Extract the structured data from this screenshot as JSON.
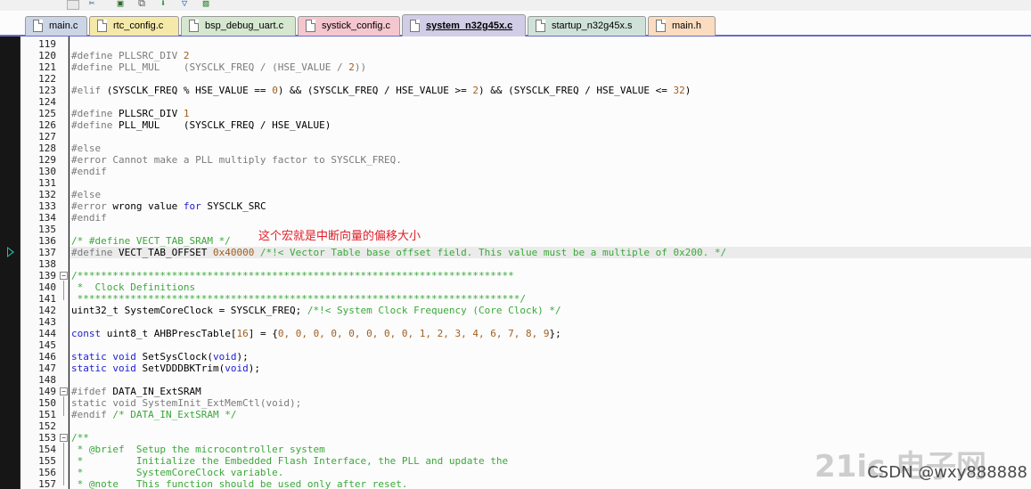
{
  "toolbar": {
    "icons": [
      "dropdown-icon",
      "tools-icon",
      "save-icon",
      "windows-icon",
      "download-icon",
      "filter-icon",
      "image-icon"
    ]
  },
  "tabs": [
    {
      "label": "main.c",
      "color": "#cbd5e6",
      "active": false
    },
    {
      "label": "rtc_config.c",
      "color": "#f4e9a8",
      "active": false
    },
    {
      "label": "bsp_debug_uart.c",
      "color": "#d6e7d0",
      "active": false
    },
    {
      "label": "systick_config.c",
      "color": "#f4c7cf",
      "active": false
    },
    {
      "label": "system_n32g45x.c",
      "color": "#d2cde6",
      "active": true
    },
    {
      "label": "startup_n32g45x.s",
      "color": "#cfe2da",
      "active": false
    },
    {
      "label": "main.h",
      "color": "#fbdcc0",
      "active": false
    }
  ],
  "editor": {
    "first_line": 119,
    "current_line": 137,
    "annotation": "这个宏就是中断向量的偏移大小",
    "lines": [
      {
        "n": 119,
        "segs": []
      },
      {
        "n": 120,
        "segs": [
          {
            "t": "#define",
            "c": "pp"
          },
          {
            "t": " PLLSRC_DIV ",
            "c": "pp"
          },
          {
            "t": "2",
            "c": "num"
          }
        ]
      },
      {
        "n": 121,
        "segs": [
          {
            "t": "#define",
            "c": "pp"
          },
          {
            "t": " PLL_MUL    (SYSCLK_FREQ / (HSE_VALUE / ",
            "c": "pp"
          },
          {
            "t": "2",
            "c": "num"
          },
          {
            "t": "))",
            "c": "pp"
          }
        ]
      },
      {
        "n": 122,
        "segs": []
      },
      {
        "n": 123,
        "segs": [
          {
            "t": "#elif",
            "c": "pp"
          },
          {
            "t": " (SYSCLK_FREQ % HSE_VALUE == ",
            "c": ""
          },
          {
            "t": "0",
            "c": "num"
          },
          {
            "t": ") && (SYSCLK_FREQ / HSE_VALUE >= ",
            "c": ""
          },
          {
            "t": "2",
            "c": "num"
          },
          {
            "t": ") && (SYSCLK_FREQ / HSE_VALUE <= ",
            "c": ""
          },
          {
            "t": "32",
            "c": "num"
          },
          {
            "t": ")",
            "c": ""
          }
        ]
      },
      {
        "n": 124,
        "segs": []
      },
      {
        "n": 125,
        "segs": [
          {
            "t": "#define",
            "c": "pp"
          },
          {
            "t": " PLLSRC_DIV ",
            "c": ""
          },
          {
            "t": "1",
            "c": "num"
          }
        ]
      },
      {
        "n": 126,
        "segs": [
          {
            "t": "#define",
            "c": "pp"
          },
          {
            "t": " PLL_MUL    (SYSCLK_FREQ / HSE_VALUE)",
            "c": ""
          }
        ]
      },
      {
        "n": 127,
        "segs": []
      },
      {
        "n": 128,
        "segs": [
          {
            "t": "#else",
            "c": "pp"
          }
        ]
      },
      {
        "n": 129,
        "segs": [
          {
            "t": "#error",
            "c": "pp"
          },
          {
            "t": " Cannot make a PLL multiply factor to SYSCLK_FREQ.",
            "c": "pp"
          }
        ]
      },
      {
        "n": 130,
        "segs": [
          {
            "t": "#endif",
            "c": "pp"
          }
        ]
      },
      {
        "n": 131,
        "segs": []
      },
      {
        "n": 132,
        "segs": [
          {
            "t": "#else",
            "c": "pp"
          }
        ]
      },
      {
        "n": 133,
        "segs": [
          {
            "t": "#error",
            "c": "pp"
          },
          {
            "t": " wrong value ",
            "c": ""
          },
          {
            "t": "for",
            "c": "kw"
          },
          {
            "t": " SYSCLK_SRC",
            "c": ""
          }
        ]
      },
      {
        "n": 134,
        "segs": [
          {
            "t": "#endif",
            "c": "pp"
          }
        ]
      },
      {
        "n": 135,
        "segs": []
      },
      {
        "n": 136,
        "segs": [
          {
            "t": "/* #define VECT_TAB_SRAM */",
            "c": "cm"
          }
        ]
      },
      {
        "n": 137,
        "segs": [
          {
            "t": "#define",
            "c": "pp"
          },
          {
            "t": " VECT_TAB_OFFSET ",
            "c": ""
          },
          {
            "t": "0x40000",
            "c": "num"
          },
          {
            "t": " /*!< Vector Table base offset field. This value must be a multiple of 0x200. */",
            "c": "cm"
          }
        ]
      },
      {
        "n": 138,
        "segs": []
      },
      {
        "n": 139,
        "segs": [
          {
            "t": "/**************************************************************************",
            "c": "cm"
          }
        ]
      },
      {
        "n": 140,
        "segs": [
          {
            "t": " *  Clock Definitions",
            "c": "cm"
          }
        ]
      },
      {
        "n": 141,
        "segs": [
          {
            "t": " ***************************************************************************/",
            "c": "cm"
          }
        ]
      },
      {
        "n": 142,
        "segs": [
          {
            "t": "uint32_t SystemCoreClock = SYSCLK_FREQ; ",
            "c": ""
          },
          {
            "t": "/*!< System Clock Frequency (Core Clock) */",
            "c": "cm"
          }
        ]
      },
      {
        "n": 143,
        "segs": []
      },
      {
        "n": 144,
        "segs": [
          {
            "t": "const",
            "c": "kw"
          },
          {
            "t": " uint8_t AHBPrescTable[",
            "c": ""
          },
          {
            "t": "16",
            "c": "num"
          },
          {
            "t": "] = {",
            "c": ""
          },
          {
            "t": "0, 0, 0, 0, 0, 0, 0, 0, 1, 2, 3, 4, 6, 7, 8, 9",
            "c": "num"
          },
          {
            "t": "};",
            "c": ""
          }
        ]
      },
      {
        "n": 145,
        "segs": []
      },
      {
        "n": 146,
        "segs": [
          {
            "t": "static",
            "c": "kw"
          },
          {
            "t": " ",
            "c": ""
          },
          {
            "t": "void",
            "c": "kw"
          },
          {
            "t": " SetSysClock(",
            "c": ""
          },
          {
            "t": "void",
            "c": "kw"
          },
          {
            "t": ");",
            "c": ""
          }
        ]
      },
      {
        "n": 147,
        "segs": [
          {
            "t": "static",
            "c": "kw"
          },
          {
            "t": " ",
            "c": ""
          },
          {
            "t": "void",
            "c": "kw"
          },
          {
            "t": " SetVDDDBKTrim(",
            "c": ""
          },
          {
            "t": "void",
            "c": "kw"
          },
          {
            "t": ");",
            "c": ""
          }
        ]
      },
      {
        "n": 148,
        "segs": []
      },
      {
        "n": 149,
        "segs": [
          {
            "t": "#ifdef",
            "c": "pp"
          },
          {
            "t": " DATA_IN_ExtSRAM",
            "c": ""
          }
        ]
      },
      {
        "n": 150,
        "segs": [
          {
            "t": "static void SystemInit_ExtMemCtl(void);",
            "c": "pp"
          }
        ]
      },
      {
        "n": 151,
        "segs": [
          {
            "t": "#endif",
            "c": "pp"
          },
          {
            "t": " /* DATA_IN_ExtSRAM */",
            "c": "cm"
          }
        ]
      },
      {
        "n": 152,
        "segs": []
      },
      {
        "n": 153,
        "segs": [
          {
            "t": "/**",
            "c": "cm"
          }
        ]
      },
      {
        "n": 154,
        "segs": [
          {
            "t": " * @brief  Setup the microcontroller system",
            "c": "cm"
          }
        ]
      },
      {
        "n": 155,
        "segs": [
          {
            "t": " *         Initialize the Embedded Flash Interface, the PLL and update the",
            "c": "cm"
          }
        ]
      },
      {
        "n": 156,
        "segs": [
          {
            "t": " *         SystemCoreClock variable.",
            "c": "cm"
          }
        ]
      },
      {
        "n": 157,
        "segs": [
          {
            "t": " * @note   This function should be used only after reset.",
            "c": "cm"
          }
        ]
      }
    ],
    "folds": [
      139,
      149,
      153
    ]
  },
  "watermark": {
    "text": "CSDN @wxy888888",
    "logo": "21ic 电子网"
  }
}
